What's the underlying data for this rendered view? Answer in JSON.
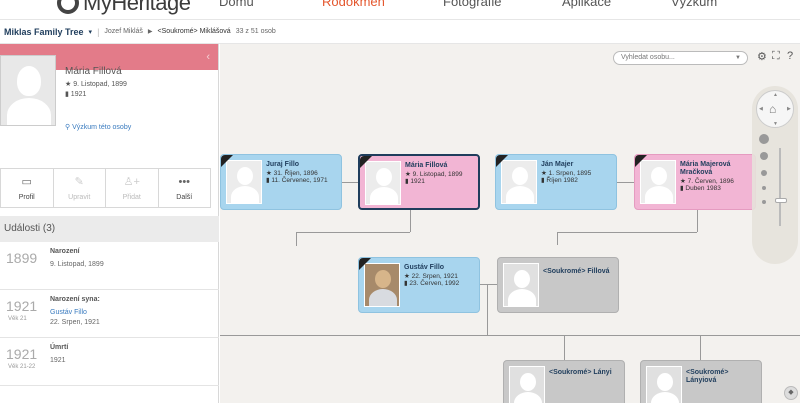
{
  "nav": {
    "brand": "MyHeritage",
    "tabs": [
      "Domů",
      "Rodokmen",
      "Fotografie",
      "Aplikace",
      "Výzkum"
    ],
    "active_tab": 1,
    "accent": "#e4572e"
  },
  "breadcrumb": {
    "tree": "Miklas Family Tree",
    "owner": "Jozef Mikláš",
    "current": "<Soukromé> Miklášová",
    "count": "33 z 51 osob"
  },
  "profile": {
    "name": "Mária Fillová",
    "birth": "9. Listopad, 1899",
    "death": "1921",
    "research_link": "Výzkum této osoby",
    "actions": [
      "Profil",
      "Upravit",
      "Přidat",
      "Další"
    ],
    "strip_color": "#e37b89"
  },
  "events": {
    "header": "Události (3)",
    "items": [
      {
        "year": "1899",
        "age": "",
        "title": "Narození",
        "link": "",
        "detail": "9. Listopad, 1899"
      },
      {
        "year": "1921",
        "age": "Věk 21",
        "title": "Narození syna:",
        "link": "Gustáv Fillo",
        "detail": "22. Srpen, 1921"
      },
      {
        "year": "1921",
        "age": "Věk 21-22",
        "title": "Úmrtí",
        "link": "",
        "detail": "1921"
      }
    ]
  },
  "toolbar": {
    "search_placeholder": "Vyhledat osobu...",
    "icons": [
      "gear-icon",
      "fullscreen-icon",
      "help-icon"
    ]
  },
  "cards": [
    {
      "id": "juraj",
      "name": "Juraj Fillo",
      "l1": "★ 31. Říjen, 1896",
      "l2": "▮ 11. Červenec, 1971",
      "color": "blue",
      "deceased": true,
      "selected": false
    },
    {
      "id": "maria",
      "name": "Mária Fillová",
      "l1": "★ 9. Listopad, 1899",
      "l2": "▮ 1921",
      "color": "pink",
      "deceased": true,
      "selected": true
    },
    {
      "id": "jan",
      "name": "Ján Majer",
      "l1": "★ 1. Srpen, 1895",
      "l2": "▮ Říjen 1982",
      "color": "blue",
      "deceased": true,
      "selected": false
    },
    {
      "id": "mariam",
      "name": "Mária Majerová Mračková",
      "l1": "★ 7. Červen, 1896",
      "l2": "▮ Duben 1983",
      "color": "pink",
      "deceased": true,
      "selected": false
    },
    {
      "id": "gustav",
      "name": "Gustáv Fillo",
      "l1": "★ 22. Srpen, 1921",
      "l2": "▮ 23. Červen, 1992",
      "color": "blue",
      "deceased": true,
      "selected": false
    },
    {
      "id": "privf",
      "name": "<Soukromé> Fillová",
      "l1": "",
      "l2": "",
      "color": "gray",
      "deceased": false,
      "selected": false
    },
    {
      "id": "lanyi",
      "name": "<Soukromé> Lányi",
      "l1": "",
      "l2": "",
      "color": "gray",
      "deceased": false,
      "selected": false
    },
    {
      "id": "lanyiova",
      "name": "<Soukromé> Lányiová",
      "l1": "",
      "l2": "",
      "color": "gray",
      "deceased": false,
      "selected": false
    }
  ]
}
